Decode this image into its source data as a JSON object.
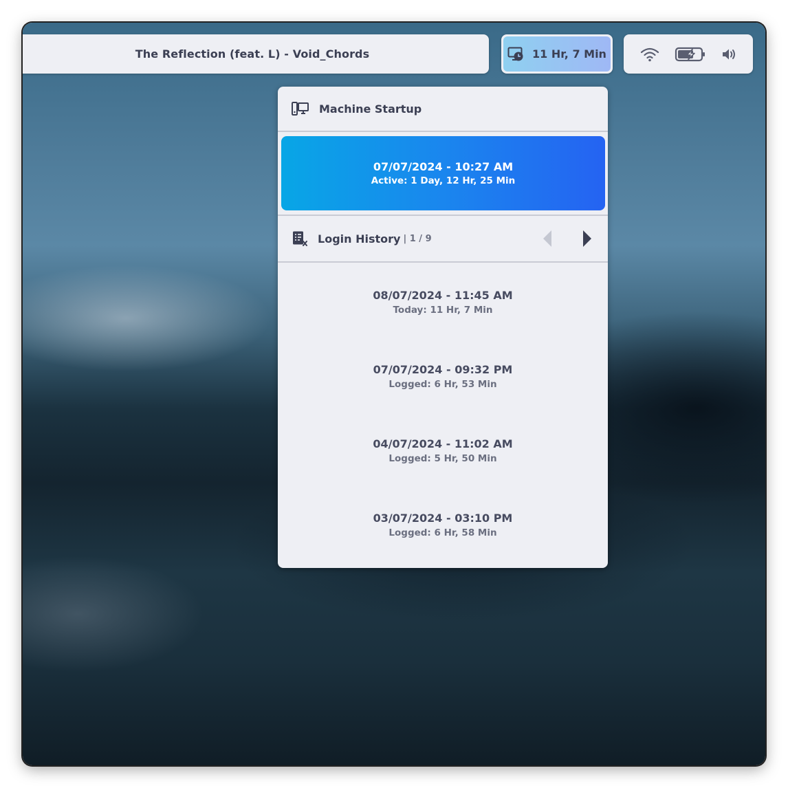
{
  "topbar": {
    "media_title": "The Reflection (feat. L) - Void_Chords",
    "session_time": "11 Hr, 7 Min",
    "icons": [
      "session-clock-icon",
      "wifi-icon",
      "battery-charging-icon",
      "volume-icon"
    ]
  },
  "popup": {
    "machine_startup": {
      "label": "Machine Startup",
      "date": "07/07/2024 - 10:27 AM",
      "active": "Active: 1 Day, 12 Hr, 25 Min"
    },
    "login_history": {
      "label": "Login History",
      "page": "| 1 / 9",
      "items": [
        {
          "date": "08/07/2024 - 11:45 AM",
          "duration": "Today: 11 Hr, 7 Min"
        },
        {
          "date": "07/07/2024 - 09:32 PM",
          "duration": "Logged: 6 Hr, 53 Min"
        },
        {
          "date": "04/07/2024 - 11:02 AM",
          "duration": "Logged: 5 Hr, 50 Min"
        },
        {
          "date": "03/07/2024 - 03:10 PM",
          "duration": "Logged: 6 Hr, 58 Min"
        }
      ]
    }
  },
  "colors": {
    "panel_bg": "#eeeff4",
    "text": "#3b3f53",
    "accent_start": "#08a6e6",
    "accent_end": "#2563f2"
  }
}
